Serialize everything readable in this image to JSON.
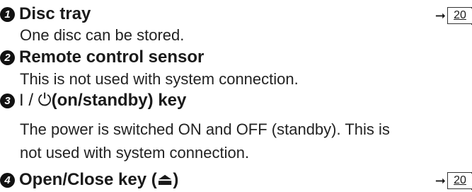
{
  "entries": [
    {
      "number": "1",
      "title": "Disc tray",
      "description": [
        "One disc can be stored."
      ],
      "page_ref": "20"
    },
    {
      "number": "2",
      "title": "Remote control sensor",
      "description": [
        "This is not used with system connection."
      ]
    },
    {
      "number": "3",
      "title_symbol": "I / ⏻",
      "title": "(on/standby) key",
      "description": [
        "The power is switched ON and OFF (standby). This is",
        "not used with system connection."
      ]
    },
    {
      "number": "4",
      "title": "Open/Close key (⏏)",
      "page_ref": "20"
    }
  ]
}
